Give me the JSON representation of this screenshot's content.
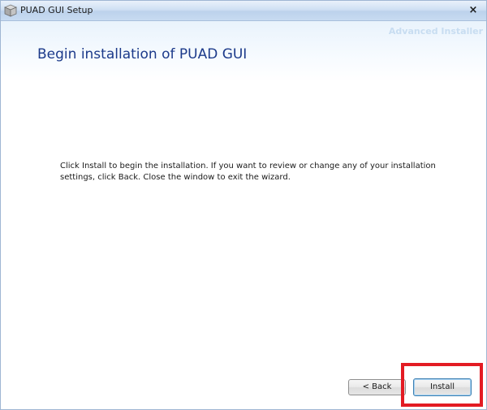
{
  "window": {
    "title": "PUAD GUI Setup",
    "close_glyph": "×",
    "app_icon": "box-icon"
  },
  "header": {
    "brand": "Advanced Installer",
    "page_title": "Begin installation of PUAD GUI"
  },
  "content": {
    "instructions": "Click Install to begin the installation.  If you want to review or change any of your installation settings, click Back.  Close the window to exit the wizard."
  },
  "buttons": {
    "back_label": "< Back",
    "install_label": "Install"
  },
  "colors": {
    "title_blue": "#1c3a8a",
    "highlight_red": "#e31b23"
  }
}
